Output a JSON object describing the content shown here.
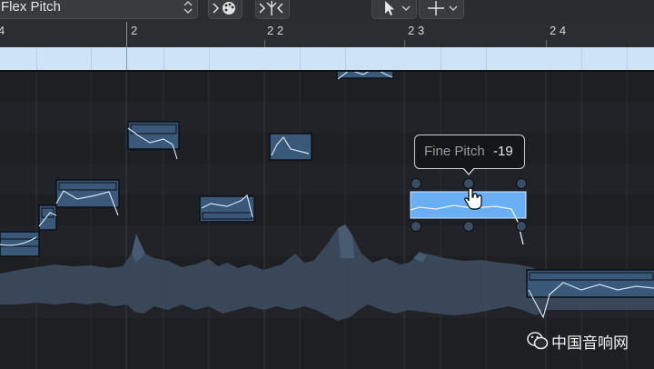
{
  "toolbar": {
    "mode_label": "Flex Pitch",
    "buttons": [
      {
        "name": "midi-in-button",
        "icon": "palette-icon"
      },
      {
        "name": "catch-button",
        "icon": "catch-icon"
      },
      {
        "name": "pointer-tool-button",
        "icon": "pointer-icon"
      },
      {
        "name": "marquee-tool-button",
        "icon": "crosshair-icon"
      }
    ]
  },
  "ruler": {
    "labels": [
      "4",
      "2",
      "2 2",
      "2 3",
      "2 4"
    ]
  },
  "tooltip": {
    "label": "Fine Pitch",
    "value": "-19"
  },
  "watermark": {
    "text": "中国音响网",
    "icon": "wechat-icon"
  },
  "colors": {
    "background": "#1b1c20",
    "note": "#3a5877",
    "note_selected": "#6aaef4",
    "waveform": "#3b4a5c",
    "region_bar": "#cfe3f7"
  }
}
